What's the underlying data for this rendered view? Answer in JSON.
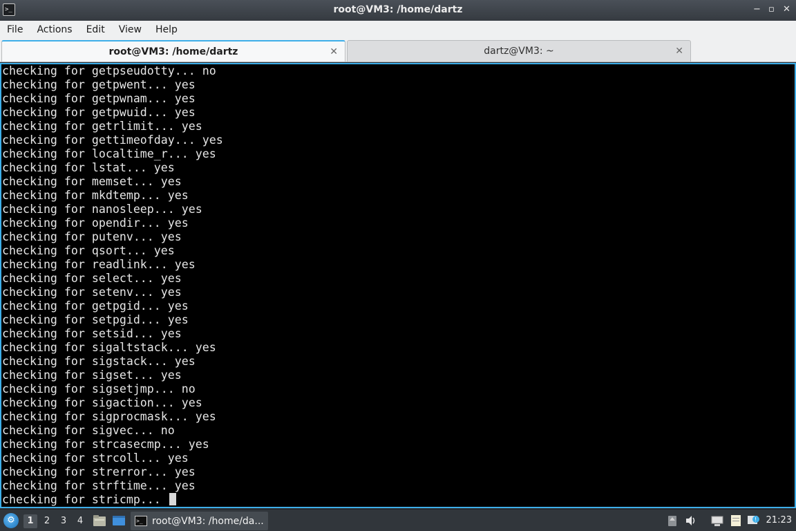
{
  "window": {
    "title": "root@VM3: /home/dartz",
    "app_icon_glyph": ">_",
    "controls": {
      "minimize": "−",
      "maximize": "▫",
      "close": "✕"
    }
  },
  "menu": [
    "File",
    "Actions",
    "Edit",
    "View",
    "Help"
  ],
  "tabs": [
    {
      "label": "root@VM3: /home/dartz",
      "active": true
    },
    {
      "label": "dartz@VM3: ~",
      "active": false
    }
  ],
  "tab_close_glyph": "✕",
  "terminal": {
    "lines": [
      "checking for getpseudotty... no",
      "checking for getpwent... yes",
      "checking for getpwnam... yes",
      "checking for getpwuid... yes",
      "checking for getrlimit... yes",
      "checking for gettimeofday... yes",
      "checking for localtime_r... yes",
      "checking for lstat... yes",
      "checking for memset... yes",
      "checking for mkdtemp... yes",
      "checking for nanosleep... yes",
      "checking for opendir... yes",
      "checking for putenv... yes",
      "checking for qsort... yes",
      "checking for readlink... yes",
      "checking for select... yes",
      "checking for setenv... yes",
      "checking for getpgid... yes",
      "checking for setpgid... yes",
      "checking for setsid... yes",
      "checking for sigaltstack... yes",
      "checking for sigstack... yes",
      "checking for sigset... yes",
      "checking for sigsetjmp... no",
      "checking for sigaction... yes",
      "checking for sigprocmask... yes",
      "checking for sigvec... no",
      "checking for strcasecmp... yes",
      "checking for strcoll... yes",
      "checking for strerror... yes",
      "checking for strftime... yes"
    ],
    "current_line": "checking for stricmp... "
  },
  "taskbar": {
    "start_icon": "start-menu-icon",
    "desktops": [
      "1",
      "2",
      "3",
      "4"
    ],
    "active_desktop": "1",
    "task_label": "root@VM3: /home/da...",
    "clock": "21:23",
    "colors": {
      "accent": "#3daee9",
      "panel": "#31363b"
    }
  }
}
